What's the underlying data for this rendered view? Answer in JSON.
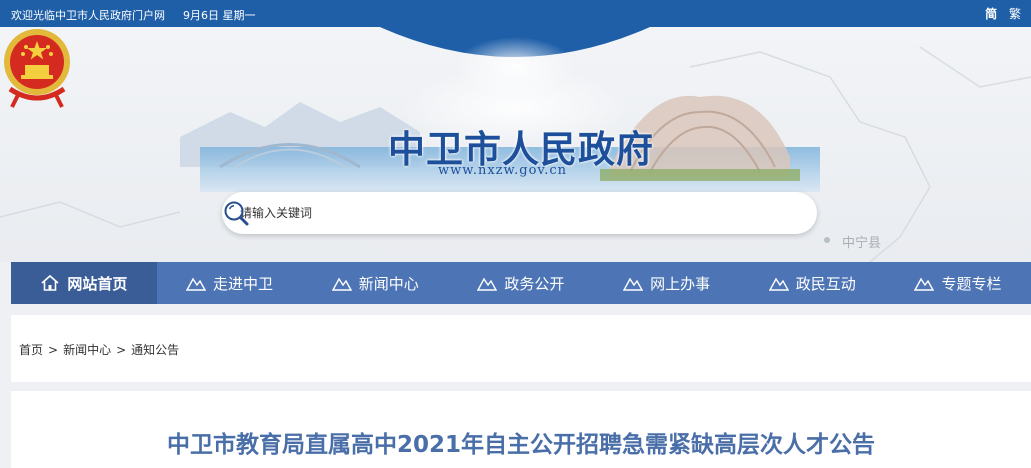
{
  "topbar": {
    "welcome": "欢迎光临中卫市人民政府门户网",
    "date": "9月6日 星期一",
    "lang_simplified": "简",
    "lang_traditional": "繁"
  },
  "banner": {
    "title": "中卫市人民政府",
    "domain": "www.nxzw.gov.cn",
    "region_label": "中宁县"
  },
  "search": {
    "placeholder": "请输入关键词"
  },
  "nav": {
    "items": [
      {
        "label": "网站首页"
      },
      {
        "label": "走进中卫"
      },
      {
        "label": "新闻中心"
      },
      {
        "label": "政务公开"
      },
      {
        "label": "网上办事"
      },
      {
        "label": "政民互动"
      },
      {
        "label": "专题专栏"
      }
    ]
  },
  "breadcrumb": {
    "items": [
      "首页",
      "新闻中心",
      "通知公告"
    ],
    "separator": ">"
  },
  "article": {
    "title": "中卫市教育局直属高中2021年自主公开招聘急需紧缺高层次人才公告"
  },
  "colors": {
    "topbar": "#1f5fa8",
    "nav": "#4d74b4",
    "nav_active": "#3a5d98",
    "title_blue": "#1d4f9a",
    "article_title": "#4a6fa8"
  }
}
